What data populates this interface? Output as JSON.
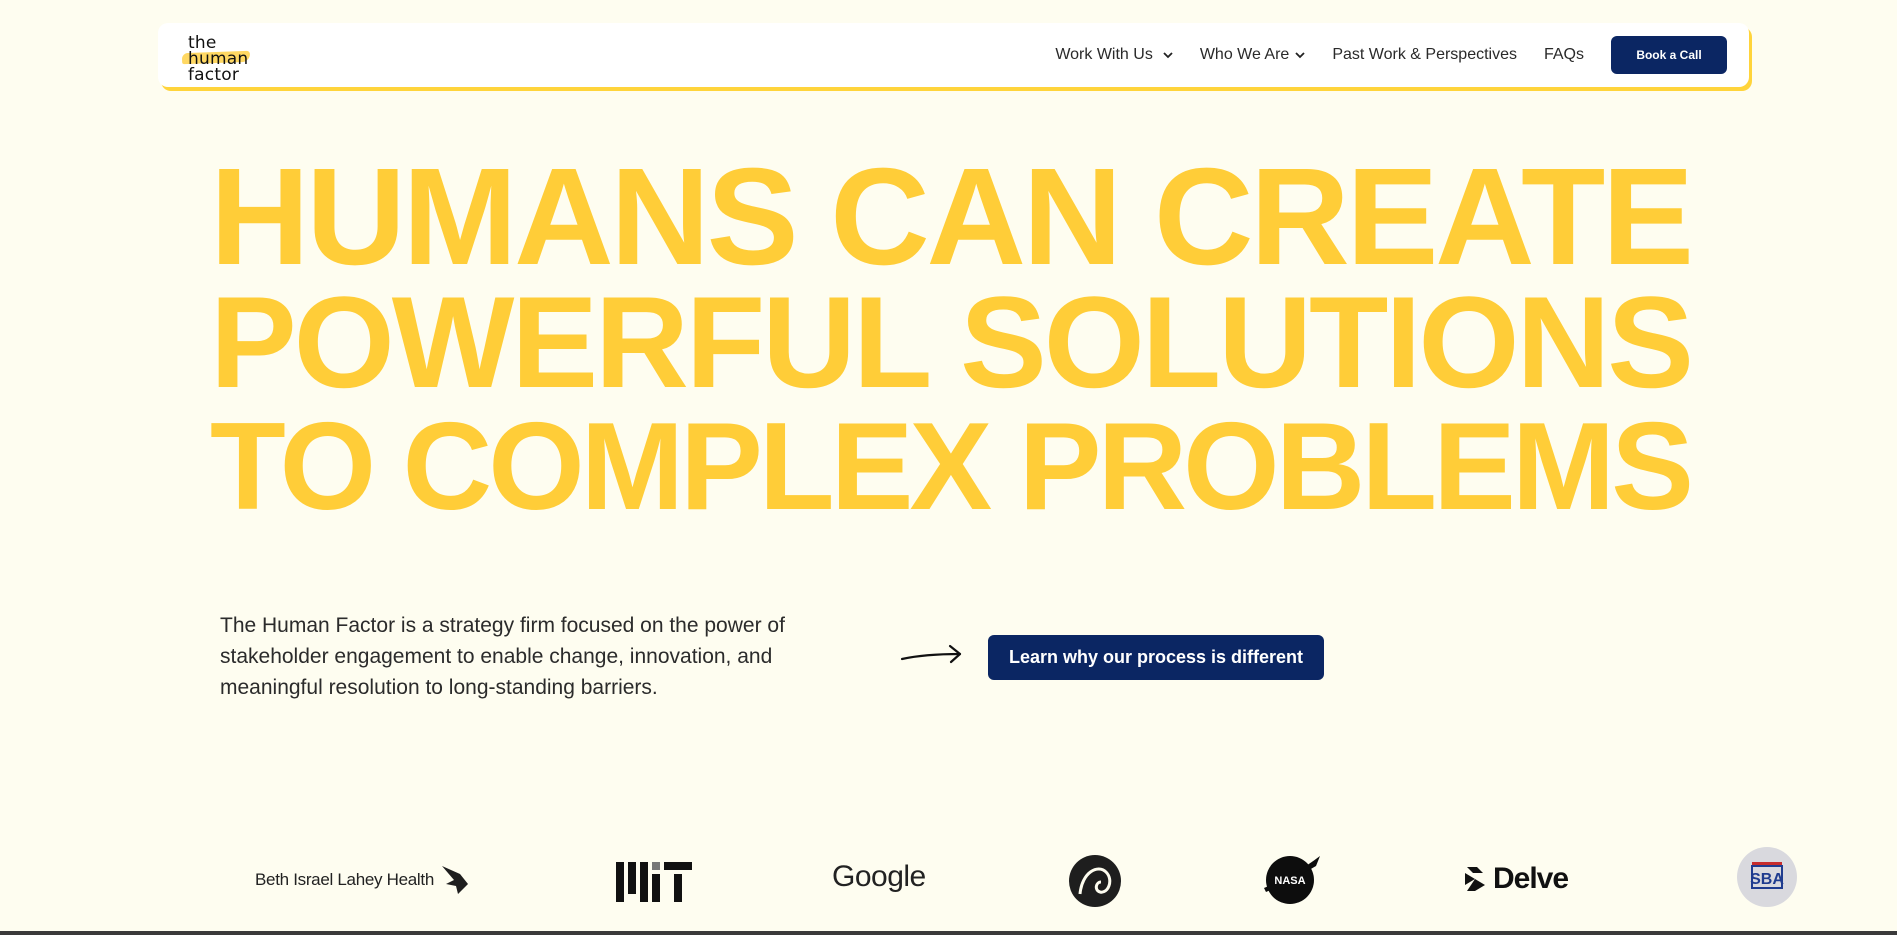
{
  "header": {
    "logo_lines": [
      "the",
      "human",
      "factor"
    ],
    "nav": [
      {
        "label": "Work With Us",
        "has_dropdown": true
      },
      {
        "label": "Who We Are",
        "has_dropdown": true
      },
      {
        "label": "Past Work & Perspectives",
        "has_dropdown": false
      },
      {
        "label": "FAQs",
        "has_dropdown": false
      }
    ],
    "cta_label": "Book a Call"
  },
  "hero": {
    "lines": [
      "HUMANS CAN CREATE",
      "POWERFUL SOLUTIONS",
      "TO COMPLEX PROBLEMS"
    ],
    "description": "The Human Factor is a strategy firm focused on the power of stakeholder engagement to enable change, innovation, and meaningful resolution to long-standing barriers.",
    "cta_label": "Learn why our process is different"
  },
  "client_logos": {
    "bilh": "Beth Israel Lahey Health",
    "google": "Google",
    "delve": "Delve",
    "nasa": "NASA",
    "sba": "SBA",
    "icons": [
      "bilh-bird-icon",
      "mit-logo-icon",
      "circle-logo-icon",
      "nasa-meatball-icon",
      "delve-mark-icon",
      "sba-seal-icon",
      "arrow-right-icon",
      "chevron-down-icon"
    ]
  },
  "colors": {
    "background": "#fefdf0",
    "hero_yellow": "#ffcd38",
    "navy": "#0b2663",
    "header_shadow": "#ffd43b"
  }
}
